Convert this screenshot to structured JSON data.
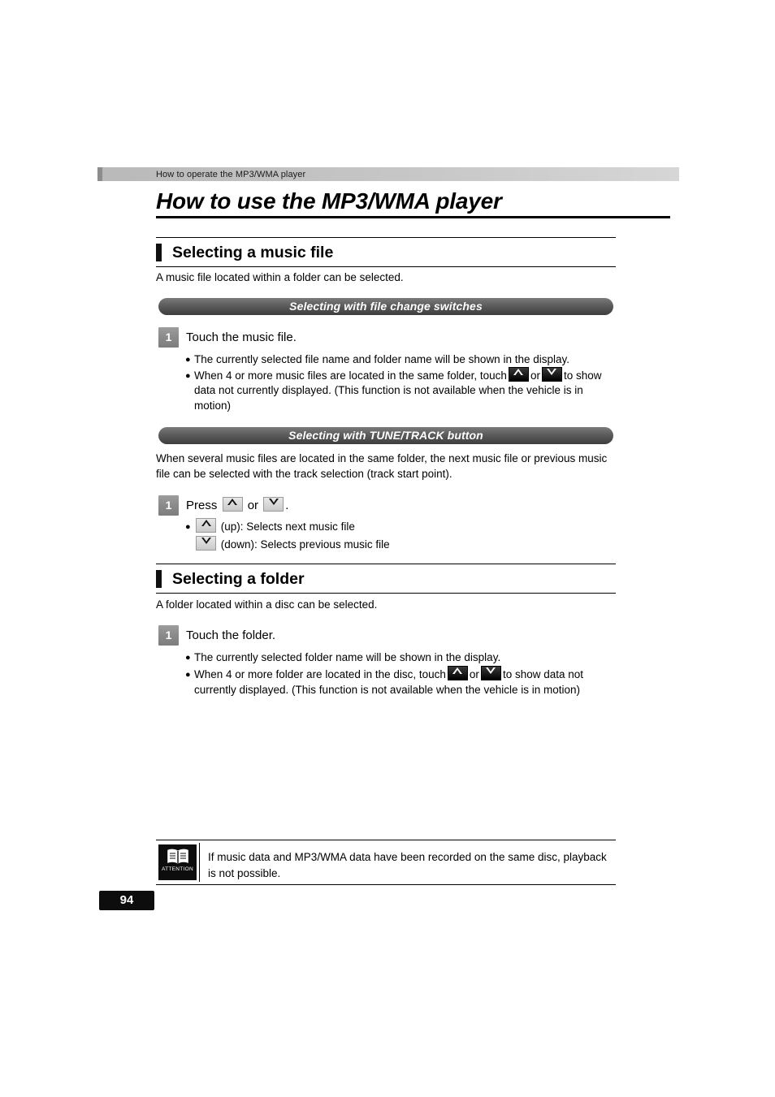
{
  "header": {
    "running_head": "How to operate the MP3/WMA player"
  },
  "chapter": {
    "title": "How to use the MP3/WMA player"
  },
  "sections": [
    {
      "heading": "Selecting a music file",
      "intro": "A music file located within a folder can be selected.",
      "subsections": [
        {
          "pill": "Selecting with file change switches",
          "step_number": "1",
          "step_text": "Touch the music file.",
          "bullets": [
            "The currently selected file name and folder name will be shown in the display.",
            "When 4 or more music files are located in the same folder, touch",
            "data not currently displayed. (This function is not available when the vehicle is in",
            "motion)"
          ],
          "bullet2_mid": "or",
          "bullet2_tail": "to show"
        },
        {
          "pill": "Selecting with TUNE/TRACK button",
          "intro_line1": "When several music files are located in the same folder, the next music file or previous music",
          "intro_line2": "file can be selected with the track selection (track start point).",
          "step_number": "1",
          "step_text_pre": "Press",
          "step_text_mid": "or",
          "step_text_post": ".",
          "bullets": [
            "(up): Selects next music file",
            "(down): Selects previous music file"
          ]
        }
      ]
    },
    {
      "heading": "Selecting a folder",
      "intro": "A folder located within a disc can be selected.",
      "step_number": "1",
      "step_text": "Touch the folder.",
      "bullets": [
        "The currently selected folder name will be shown in the display.",
        "When 4 or more folder are located in the disc, touch",
        "currently displayed. (This function is not available when the vehicle is in motion)"
      ],
      "bullet2_mid": "or",
      "bullet2_tail": "to show data not"
    }
  ],
  "note": {
    "icon_label": "ATTENTION",
    "line1": "If music data and MP3/WMA data have been recorded on the same disc, playback",
    "line2": "is not possible."
  },
  "footer": {
    "page_number": "94"
  },
  "icons": {
    "up_arrow": "chevron-up-icon",
    "down_arrow": "chevron-down-icon",
    "book": "book-icon"
  }
}
